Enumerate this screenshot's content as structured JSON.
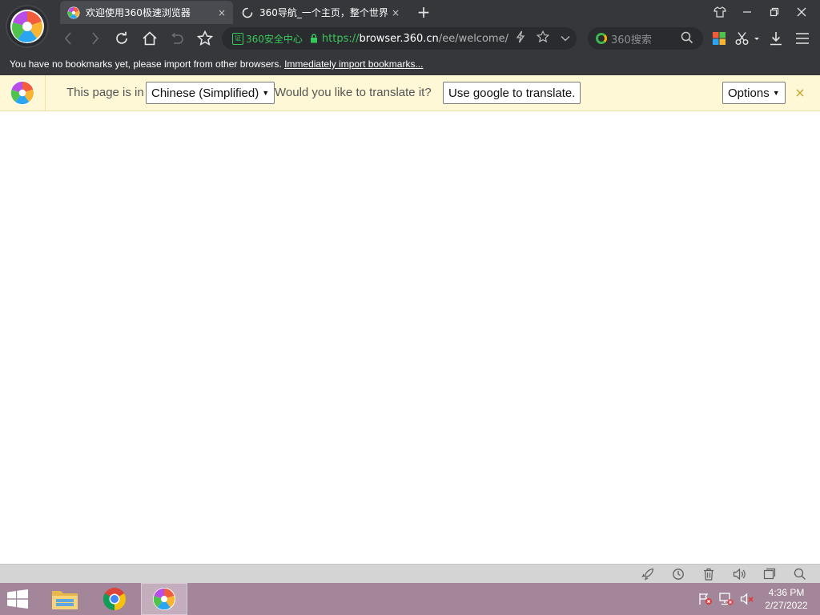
{
  "tabs": [
    {
      "title": "欢迎使用360极速浏览器",
      "close": "×",
      "icon": "360-browser-icon"
    },
    {
      "title": "360导航_一个主页，整个世界",
      "close": "×",
      "icon": "loading-spinner-icon"
    }
  ],
  "new_tab": "+",
  "address_bar": {
    "security_label": "360安全中心",
    "shield_glyph": "证",
    "url_protocol": "https://",
    "url_host": "browser.360.cn",
    "url_path": "/ee/welcome/"
  },
  "search": {
    "placeholder": "360搜索"
  },
  "bookmarks_bar": {
    "message": "You have no bookmarks yet, please import from other browsers. ",
    "link": "Immediately import bookmarks..."
  },
  "translate_bar": {
    "prefix": "This page is in",
    "language": "Chinese (Simplified)",
    "question": "Would you like to translate it?",
    "translate_button": "Use google to translate.",
    "options_button": "Options",
    "close": "×"
  },
  "taskbar": {
    "time": "4:36 PM",
    "date": "2/27/2022"
  },
  "colors": {
    "chrome_bg": "#36373b",
    "active_tab": "#4a4b50",
    "secure_green": "#39c85a",
    "translate_bg": "#fff8d6",
    "taskbar_bg": "#a3869a"
  }
}
